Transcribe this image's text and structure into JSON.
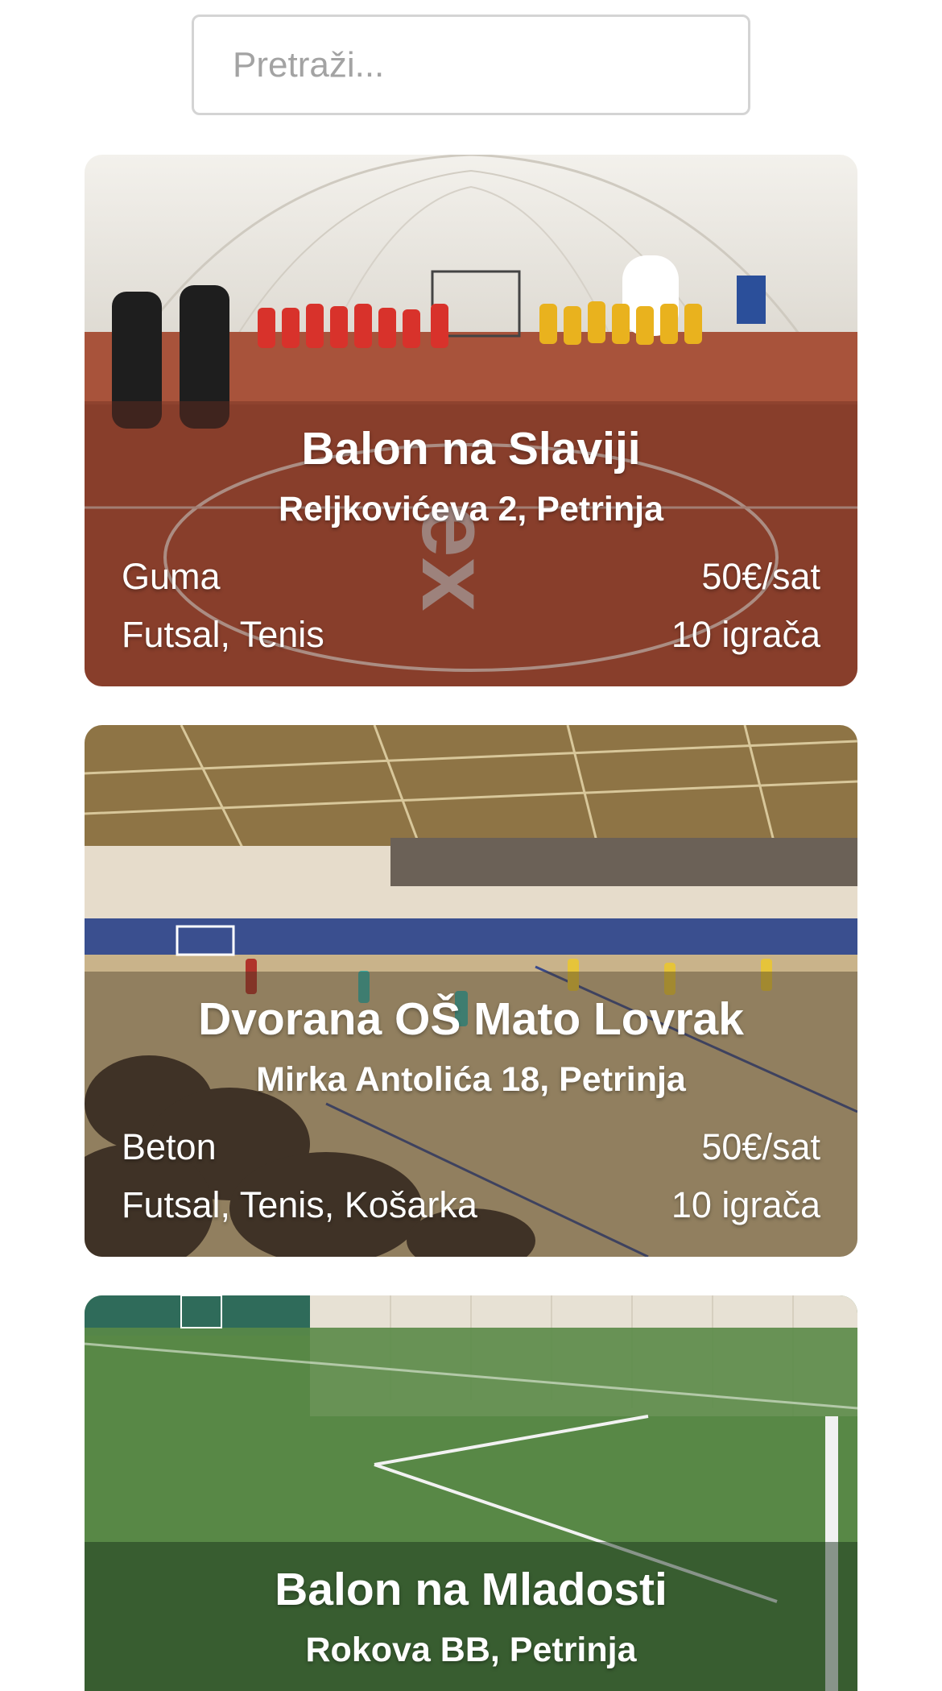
{
  "search": {
    "placeholder": "Pretraži...",
    "value": ""
  },
  "venues": [
    {
      "name": "Balon na Slaviji",
      "address": "Reljkovićeva 2, Petrinja",
      "surface": "Guma",
      "price": "50€/sat",
      "sports": "Futsal, Tenis",
      "players": "10 igrača",
      "photo": "photo-indoor-dome-handball-court"
    },
    {
      "name": "Dvorana OŠ Mato Lovrak",
      "address": "Mirka Antolića 18, Petrinja",
      "surface": "Beton",
      "price": "50€/sat",
      "sports": "Futsal, Tenis, Košarka",
      "players": "10 igrača",
      "photo": "photo-sports-hall-with-spectators"
    },
    {
      "name": "Balon na Mladosti",
      "address": "Rokova BB, Petrinja",
      "photo": "photo-indoor-turf-football-field"
    }
  ],
  "colors": {
    "search_border": "#d4d4d4",
    "placeholder": "#a3a3a3",
    "card_text": "#ffffff"
  }
}
